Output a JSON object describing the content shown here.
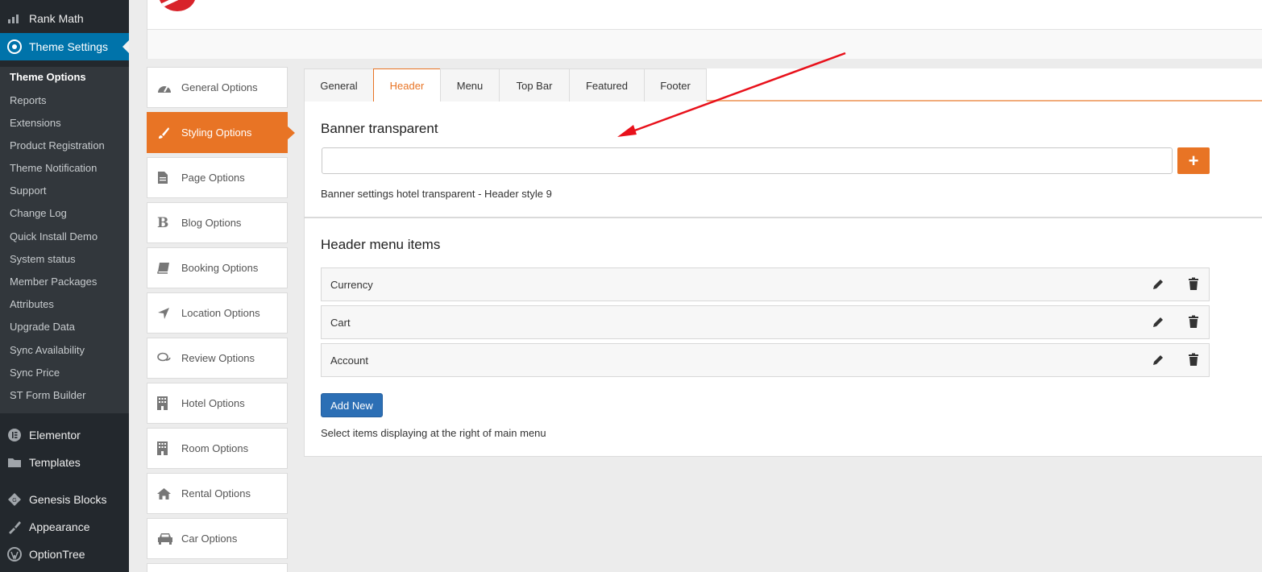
{
  "wp_menu": {
    "rank_math": "Rank Math",
    "theme_settings": "Theme Settings",
    "submenu": [
      "Theme Options",
      "Reports",
      "Extensions",
      "Product Registration",
      "Theme Notification",
      "Support",
      "Change Log",
      "Quick Install Demo",
      "System status",
      "Member Packages",
      "Attributes",
      "Upgrade Data",
      "Sync Availability",
      "Sync Price",
      "ST Form Builder"
    ],
    "elementor": "Elementor",
    "templates": "Templates",
    "genesis_blocks": "Genesis Blocks",
    "appearance": "Appearance",
    "optiontree": "OptionTree"
  },
  "ot_nav": [
    {
      "label": "General Options",
      "icon": "dashboard-icon"
    },
    {
      "label": "Styling Options",
      "icon": "paint-brush-icon"
    },
    {
      "label": "Page Options",
      "icon": "file-text-icon"
    },
    {
      "label": "Blog Options",
      "icon": "bold-b-icon"
    },
    {
      "label": "Booking Options",
      "icon": "book-icon"
    },
    {
      "label": "Location Options",
      "icon": "location-arrow-icon"
    },
    {
      "label": "Review Options",
      "icon": "comments-icon"
    },
    {
      "label": "Hotel Options",
      "icon": "building-icon"
    },
    {
      "label": "Room Options",
      "icon": "building-icon"
    },
    {
      "label": "Rental Options",
      "icon": "home-icon"
    },
    {
      "label": "Car Options",
      "icon": "car-icon"
    }
  ],
  "tabs": [
    "General",
    "Header",
    "Menu",
    "Top Bar",
    "Featured",
    "Footer"
  ],
  "active_tab": "Header",
  "banner": {
    "title": "Banner transparent",
    "value": "",
    "description": "Banner settings hotel transparent - Header style 9"
  },
  "header_menu": {
    "title": "Header menu items",
    "items": [
      "Currency",
      "Cart",
      "Account"
    ],
    "add_new": "Add New",
    "description": "Select items displaying at the right of main menu"
  },
  "colors": {
    "accent": "#e87425",
    "wp_blue": "#0073aa",
    "button_blue": "#2c6fb5",
    "annotation": "#e8111b"
  }
}
